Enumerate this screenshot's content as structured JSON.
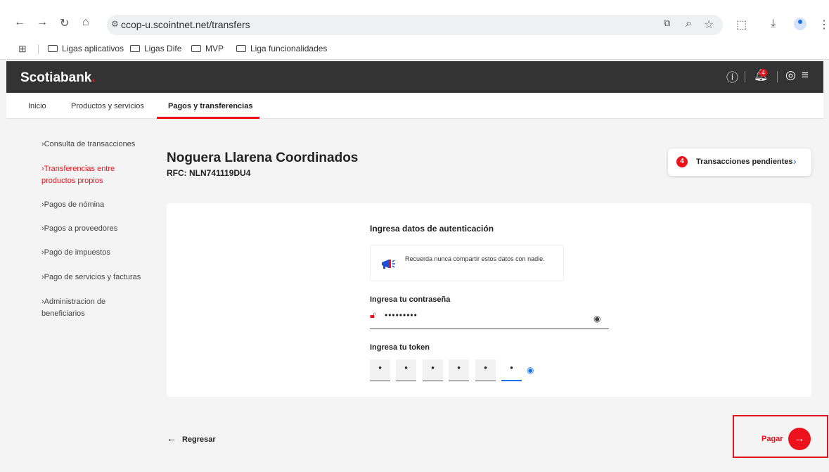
{
  "browser": {
    "url": "ccop-u.scointnet.net/transfers",
    "bookmarks": [
      "Ligas aplicativos",
      "Ligas Dife",
      "MVP",
      "Liga funcionalidades"
    ]
  },
  "header": {
    "brand": "Scotiabank",
    "brand_dot": ".",
    "notifications_count": "4"
  },
  "tabs": [
    {
      "label": "Inicio"
    },
    {
      "label": "Productos y servicios"
    },
    {
      "label": "Pagos y transferencias"
    }
  ],
  "sidebar": {
    "items": [
      {
        "label": "Consulta de transacciones"
      },
      {
        "label": "Transferencias entre productos propios"
      },
      {
        "label": "Pagos de nómina"
      },
      {
        "label": "Pagos a proveedores"
      },
      {
        "label": "Pago de impuestos"
      },
      {
        "label": "Pago de servicios y facturas"
      },
      {
        "label": "Administracion de beneficiarios"
      }
    ]
  },
  "company": {
    "name": "Noguera Llarena Coordinados",
    "rfc": "RFC: NLN741119DU4"
  },
  "pending": {
    "count": "4",
    "label": "Transacciones pendientes"
  },
  "auth": {
    "title": "Ingresa datos de autenticación",
    "notice": "Recuerda nunca compartir estos datos con nadie.",
    "password_label": "Ingresa tu contraseña",
    "password_value": "•••••••••",
    "token_label": "Ingresa tu token",
    "token_digits": [
      "•",
      "•",
      "•",
      "•",
      "•",
      "•"
    ]
  },
  "actions": {
    "back_label": "Regresar",
    "pay_label": "Pagar"
  },
  "colors": {
    "brand_red": "#ec111a",
    "header_bg": "#333333",
    "focus_blue": "#1a73e8"
  }
}
